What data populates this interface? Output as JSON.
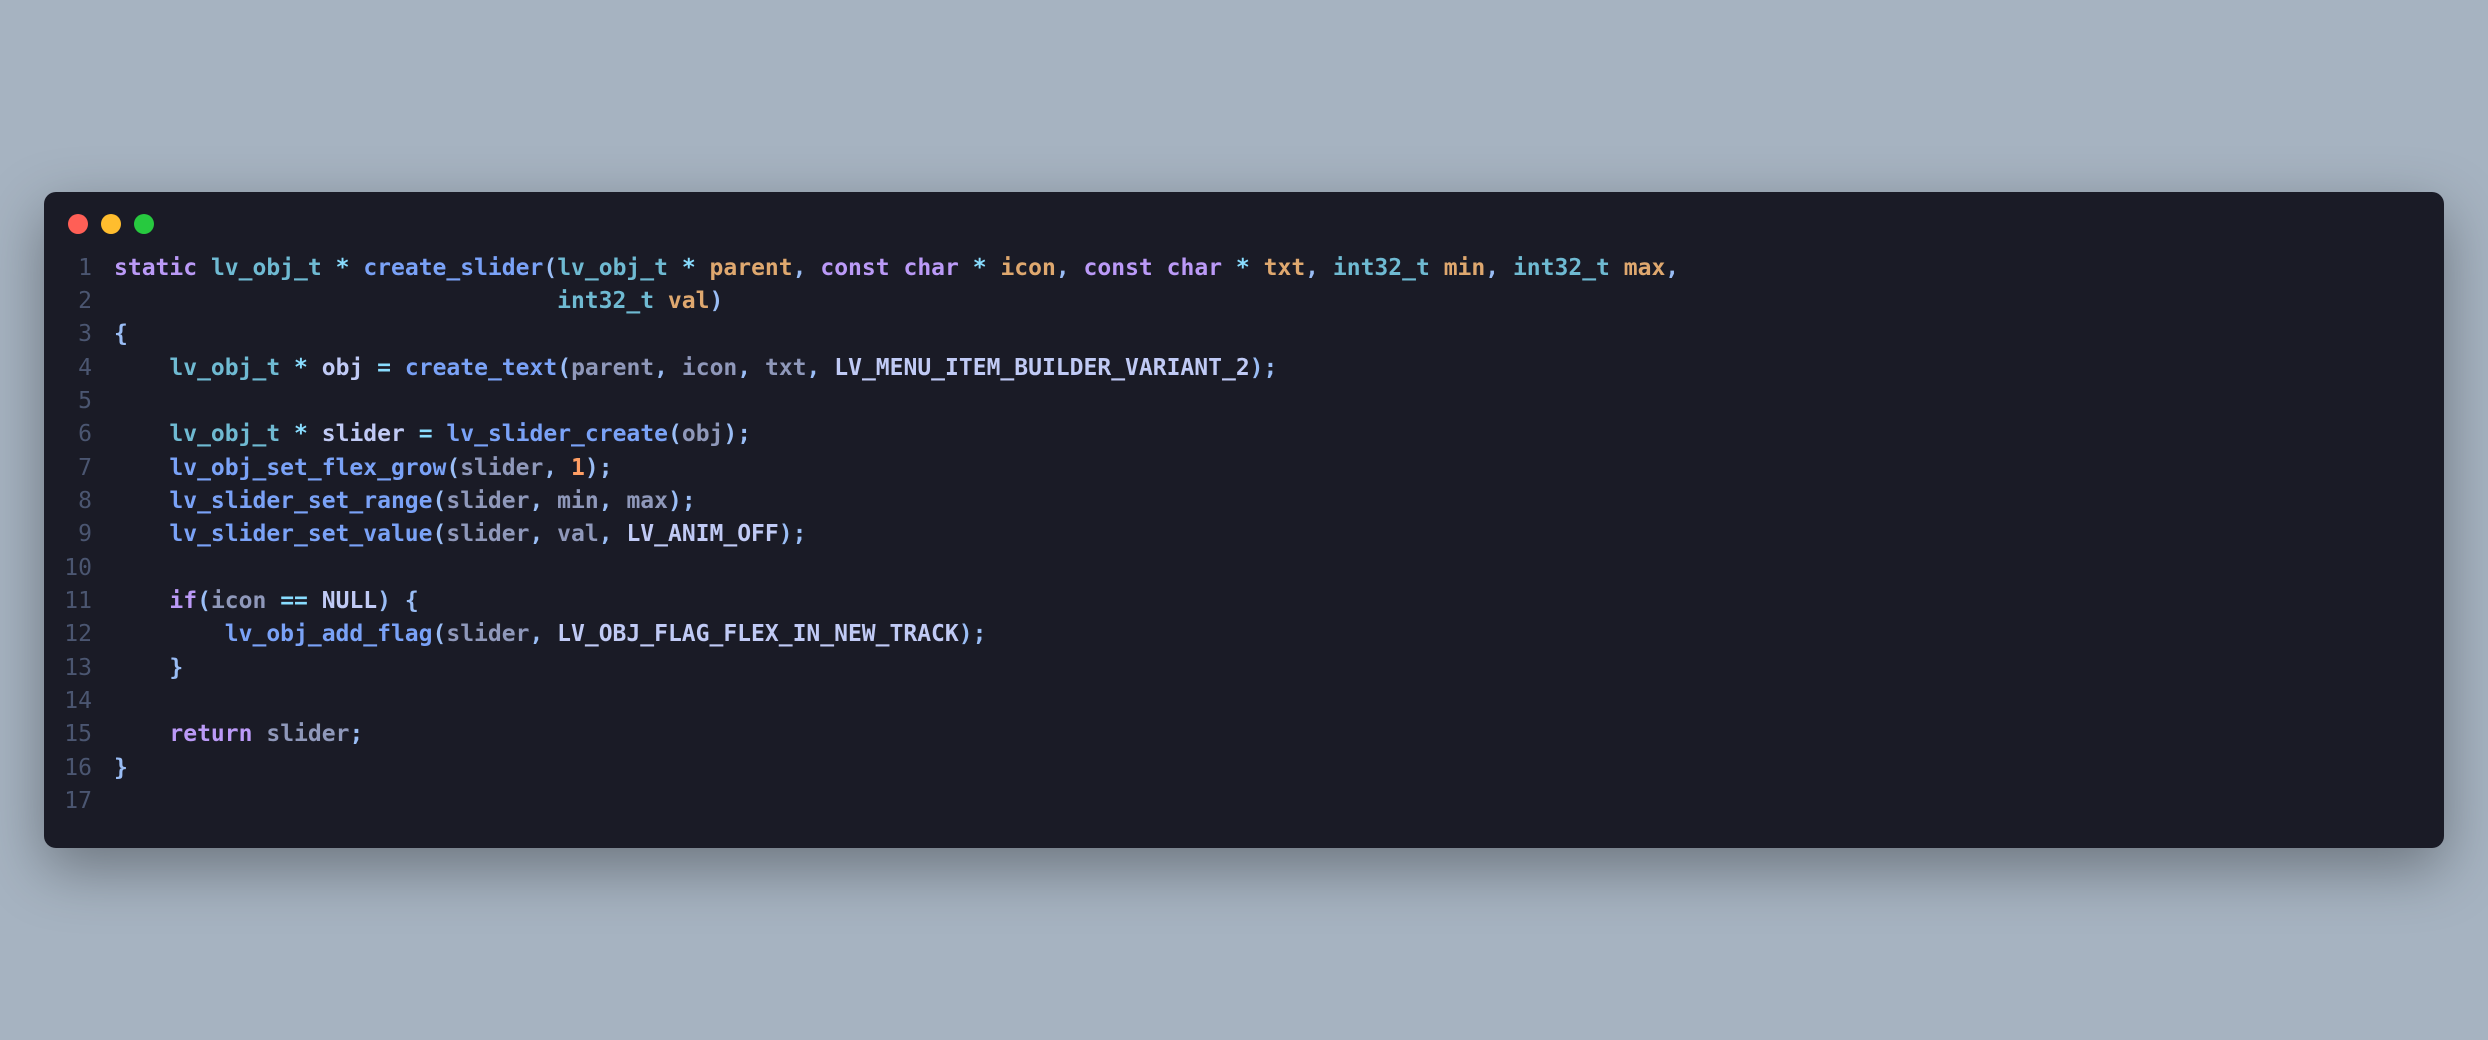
{
  "window": {
    "dots": [
      "red",
      "yellow",
      "green"
    ]
  },
  "code": {
    "lines": [
      {
        "n": "1",
        "tokens": [
          {
            "c": "kw",
            "t": "static"
          },
          {
            "c": "plain",
            "t": " "
          },
          {
            "c": "type",
            "t": "lv_obj_t"
          },
          {
            "c": "plain",
            "t": " "
          },
          {
            "c": "op",
            "t": "*"
          },
          {
            "c": "plain",
            "t": " "
          },
          {
            "c": "fn",
            "t": "create_slider"
          },
          {
            "c": "punct",
            "t": "("
          },
          {
            "c": "type",
            "t": "lv_obj_t"
          },
          {
            "c": "plain",
            "t": " "
          },
          {
            "c": "op",
            "t": "*"
          },
          {
            "c": "plain",
            "t": " "
          },
          {
            "c": "param",
            "t": "parent"
          },
          {
            "c": "punct",
            "t": ","
          },
          {
            "c": "plain",
            "t": " "
          },
          {
            "c": "kw",
            "t": "const"
          },
          {
            "c": "plain",
            "t": " "
          },
          {
            "c": "kw",
            "t": "char"
          },
          {
            "c": "plain",
            "t": " "
          },
          {
            "c": "op",
            "t": "*"
          },
          {
            "c": "plain",
            "t": " "
          },
          {
            "c": "param",
            "t": "icon"
          },
          {
            "c": "punct",
            "t": ","
          },
          {
            "c": "plain",
            "t": " "
          },
          {
            "c": "kw",
            "t": "const"
          },
          {
            "c": "plain",
            "t": " "
          },
          {
            "c": "kw",
            "t": "char"
          },
          {
            "c": "plain",
            "t": " "
          },
          {
            "c": "op",
            "t": "*"
          },
          {
            "c": "plain",
            "t": " "
          },
          {
            "c": "param",
            "t": "txt"
          },
          {
            "c": "punct",
            "t": ","
          },
          {
            "c": "plain",
            "t": " "
          },
          {
            "c": "type",
            "t": "int32_t"
          },
          {
            "c": "plain",
            "t": " "
          },
          {
            "c": "param",
            "t": "min"
          },
          {
            "c": "punct",
            "t": ","
          },
          {
            "c": "plain",
            "t": " "
          },
          {
            "c": "type",
            "t": "int32_t"
          },
          {
            "c": "plain",
            "t": " "
          },
          {
            "c": "param",
            "t": "max"
          },
          {
            "c": "punct",
            "t": ","
          }
        ]
      },
      {
        "n": "2",
        "tokens": [
          {
            "c": "plain",
            "t": "                                "
          },
          {
            "c": "type",
            "t": "int32_t"
          },
          {
            "c": "plain",
            "t": " "
          },
          {
            "c": "param",
            "t": "val"
          },
          {
            "c": "punct",
            "t": ")"
          }
        ]
      },
      {
        "n": "3",
        "tokens": [
          {
            "c": "punct",
            "t": "{"
          }
        ]
      },
      {
        "n": "4",
        "tokens": [
          {
            "c": "plain",
            "t": "    "
          },
          {
            "c": "type",
            "t": "lv_obj_t"
          },
          {
            "c": "plain",
            "t": " "
          },
          {
            "c": "op",
            "t": "*"
          },
          {
            "c": "plain",
            "t": " "
          },
          {
            "c": "id",
            "t": "obj"
          },
          {
            "c": "plain",
            "t": " "
          },
          {
            "c": "op",
            "t": "="
          },
          {
            "c": "plain",
            "t": " "
          },
          {
            "c": "fn",
            "t": "create_text"
          },
          {
            "c": "punct",
            "t": "("
          },
          {
            "c": "plain",
            "t": "parent"
          },
          {
            "c": "punct",
            "t": ","
          },
          {
            "c": "plain",
            "t": " "
          },
          {
            "c": "plain",
            "t": "icon"
          },
          {
            "c": "punct",
            "t": ","
          },
          {
            "c": "plain",
            "t": " "
          },
          {
            "c": "plain",
            "t": "txt"
          },
          {
            "c": "punct",
            "t": ","
          },
          {
            "c": "plain",
            "t": " "
          },
          {
            "c": "const",
            "t": "LV_MENU_ITEM_BUILDER_VARIANT_2"
          },
          {
            "c": "punct",
            "t": ")"
          },
          {
            "c": "punct",
            "t": ";"
          }
        ]
      },
      {
        "n": "5",
        "tokens": [
          {
            "c": "plain",
            "t": ""
          }
        ]
      },
      {
        "n": "6",
        "tokens": [
          {
            "c": "plain",
            "t": "    "
          },
          {
            "c": "type",
            "t": "lv_obj_t"
          },
          {
            "c": "plain",
            "t": " "
          },
          {
            "c": "op",
            "t": "*"
          },
          {
            "c": "plain",
            "t": " "
          },
          {
            "c": "id",
            "t": "slider"
          },
          {
            "c": "plain",
            "t": " "
          },
          {
            "c": "op",
            "t": "="
          },
          {
            "c": "plain",
            "t": " "
          },
          {
            "c": "fn",
            "t": "lv_slider_create"
          },
          {
            "c": "punct",
            "t": "("
          },
          {
            "c": "plain",
            "t": "obj"
          },
          {
            "c": "punct",
            "t": ")"
          },
          {
            "c": "punct",
            "t": ";"
          }
        ]
      },
      {
        "n": "7",
        "tokens": [
          {
            "c": "plain",
            "t": "    "
          },
          {
            "c": "fn",
            "t": "lv_obj_set_flex_grow"
          },
          {
            "c": "punct",
            "t": "("
          },
          {
            "c": "plain",
            "t": "slider"
          },
          {
            "c": "punct",
            "t": ","
          },
          {
            "c": "plain",
            "t": " "
          },
          {
            "c": "num",
            "t": "1"
          },
          {
            "c": "punct",
            "t": ")"
          },
          {
            "c": "punct",
            "t": ";"
          }
        ]
      },
      {
        "n": "8",
        "tokens": [
          {
            "c": "plain",
            "t": "    "
          },
          {
            "c": "fn",
            "t": "lv_slider_set_range"
          },
          {
            "c": "punct",
            "t": "("
          },
          {
            "c": "plain",
            "t": "slider"
          },
          {
            "c": "punct",
            "t": ","
          },
          {
            "c": "plain",
            "t": " "
          },
          {
            "c": "plain",
            "t": "min"
          },
          {
            "c": "punct",
            "t": ","
          },
          {
            "c": "plain",
            "t": " "
          },
          {
            "c": "plain",
            "t": "max"
          },
          {
            "c": "punct",
            "t": ")"
          },
          {
            "c": "punct",
            "t": ";"
          }
        ]
      },
      {
        "n": "9",
        "tokens": [
          {
            "c": "plain",
            "t": "    "
          },
          {
            "c": "fn",
            "t": "lv_slider_set_value"
          },
          {
            "c": "punct",
            "t": "("
          },
          {
            "c": "plain",
            "t": "slider"
          },
          {
            "c": "punct",
            "t": ","
          },
          {
            "c": "plain",
            "t": " "
          },
          {
            "c": "plain",
            "t": "val"
          },
          {
            "c": "punct",
            "t": ","
          },
          {
            "c": "plain",
            "t": " "
          },
          {
            "c": "const",
            "t": "LV_ANIM_OFF"
          },
          {
            "c": "punct",
            "t": ")"
          },
          {
            "c": "punct",
            "t": ";"
          }
        ]
      },
      {
        "n": "10",
        "tokens": [
          {
            "c": "plain",
            "t": ""
          }
        ]
      },
      {
        "n": "11",
        "tokens": [
          {
            "c": "plain",
            "t": "    "
          },
          {
            "c": "kw",
            "t": "if"
          },
          {
            "c": "punct",
            "t": "("
          },
          {
            "c": "plain",
            "t": "icon"
          },
          {
            "c": "plain",
            "t": " "
          },
          {
            "c": "op",
            "t": "=="
          },
          {
            "c": "plain",
            "t": " "
          },
          {
            "c": "const",
            "t": "NULL"
          },
          {
            "c": "punct",
            "t": ")"
          },
          {
            "c": "plain",
            "t": " "
          },
          {
            "c": "punct",
            "t": "{"
          }
        ]
      },
      {
        "n": "12",
        "tokens": [
          {
            "c": "plain",
            "t": "        "
          },
          {
            "c": "fn",
            "t": "lv_obj_add_flag"
          },
          {
            "c": "punct",
            "t": "("
          },
          {
            "c": "plain",
            "t": "slider"
          },
          {
            "c": "punct",
            "t": ","
          },
          {
            "c": "plain",
            "t": " "
          },
          {
            "c": "const",
            "t": "LV_OBJ_FLAG_FLEX_IN_NEW_TRACK"
          },
          {
            "c": "punct",
            "t": ")"
          },
          {
            "c": "punct",
            "t": ";"
          }
        ]
      },
      {
        "n": "13",
        "tokens": [
          {
            "c": "plain",
            "t": "    "
          },
          {
            "c": "punct",
            "t": "}"
          }
        ]
      },
      {
        "n": "14",
        "tokens": [
          {
            "c": "plain",
            "t": ""
          }
        ]
      },
      {
        "n": "15",
        "tokens": [
          {
            "c": "plain",
            "t": "    "
          },
          {
            "c": "kw",
            "t": "return"
          },
          {
            "c": "plain",
            "t": " "
          },
          {
            "c": "plain",
            "t": "slider"
          },
          {
            "c": "punct",
            "t": ";"
          }
        ]
      },
      {
        "n": "16",
        "tokens": [
          {
            "c": "punct",
            "t": "}"
          }
        ]
      },
      {
        "n": "17",
        "tokens": [
          {
            "c": "plain",
            "t": ""
          }
        ]
      }
    ]
  }
}
